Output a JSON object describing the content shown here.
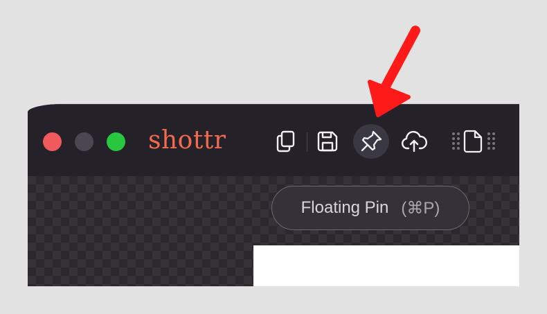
{
  "app": {
    "title": "shottr"
  },
  "toolbar": {
    "buttons": [
      {
        "name": "copy",
        "icon": "copy-icon"
      },
      {
        "name": "save",
        "icon": "save-icon"
      },
      {
        "name": "floating-pin",
        "icon": "pin-icon",
        "active": true
      },
      {
        "name": "upload",
        "icon": "cloud-upload-icon"
      },
      {
        "name": "more",
        "icon": "document-handle-icon"
      }
    ]
  },
  "tooltip": {
    "label": "Floating Pin",
    "shortcut": "(⌘P)"
  },
  "colors": {
    "accent": "#f36b4f",
    "titlebar": "#242129",
    "annotation_arrow": "#ff1a1a",
    "close": "#f15a5c",
    "maximize": "#27c840"
  }
}
